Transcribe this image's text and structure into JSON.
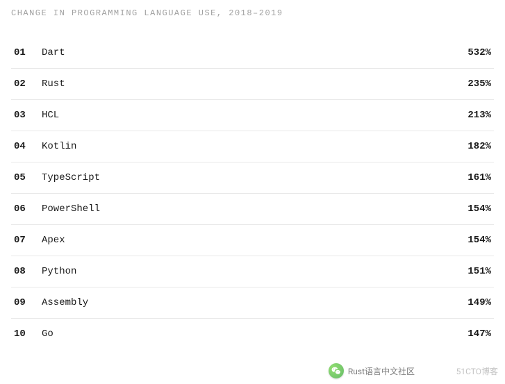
{
  "title": "CHANGE IN PROGRAMMING LANGUAGE USE, 2018–2019",
  "chart_data": {
    "type": "table",
    "title": "CHANGE IN PROGRAMMING LANGUAGE USE, 2018–2019",
    "columns": [
      "rank",
      "language",
      "percent_change"
    ],
    "rows": [
      {
        "rank": "01",
        "language": "Dart",
        "percent_change": "532%"
      },
      {
        "rank": "02",
        "language": "Rust",
        "percent_change": "235%"
      },
      {
        "rank": "03",
        "language": "HCL",
        "percent_change": "213%"
      },
      {
        "rank": "04",
        "language": "Kotlin",
        "percent_change": "182%"
      },
      {
        "rank": "05",
        "language": "TypeScript",
        "percent_change": "161%"
      },
      {
        "rank": "06",
        "language": "PowerShell",
        "percent_change": "154%"
      },
      {
        "rank": "07",
        "language": "Apex",
        "percent_change": "154%"
      },
      {
        "rank": "08",
        "language": "Python",
        "percent_change": "151%"
      },
      {
        "rank": "09",
        "language": "Assembly",
        "percent_change": "149%"
      },
      {
        "rank": "10",
        "language": "Go",
        "percent_change": "147%"
      }
    ]
  },
  "watermark": {
    "left_text": "Rust语言中文社区",
    "right_text": "51CTO博客"
  }
}
